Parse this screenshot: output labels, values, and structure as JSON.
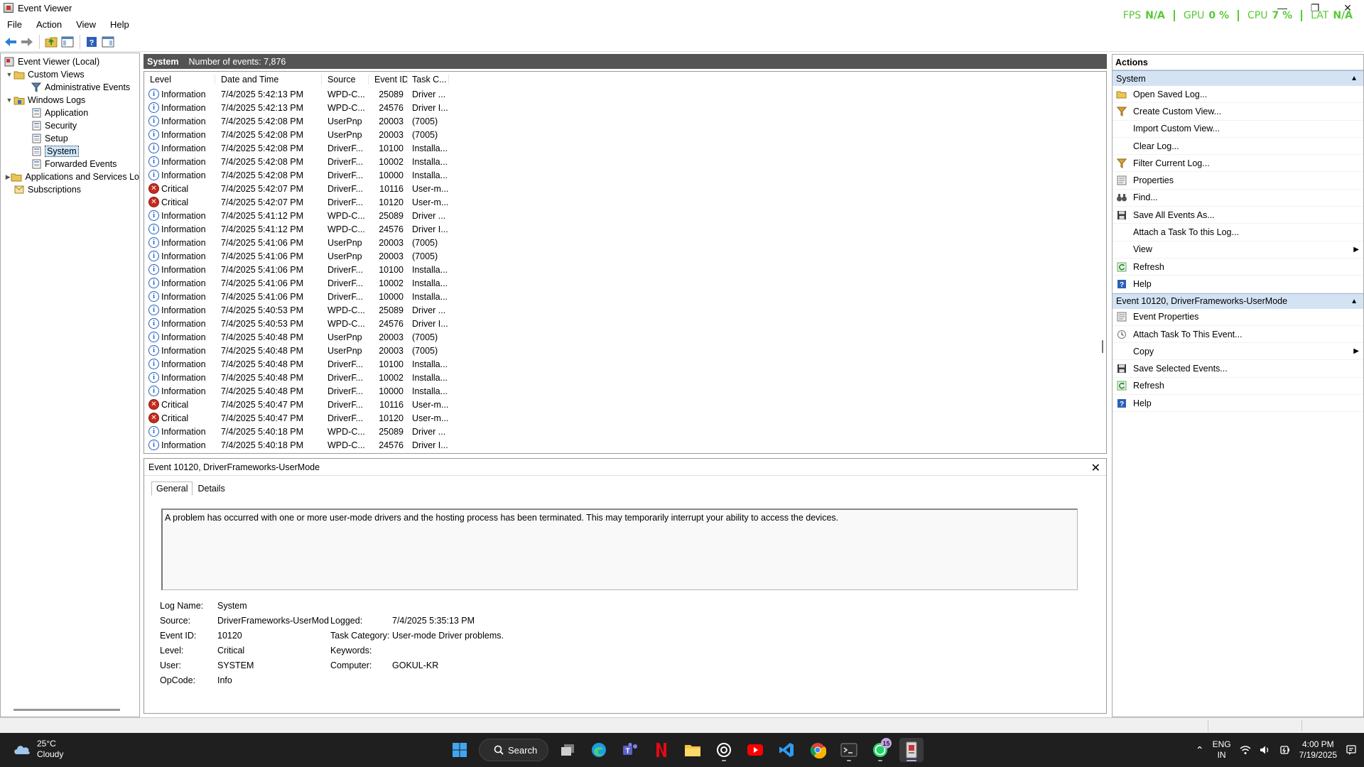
{
  "window": {
    "title": "Event Viewer",
    "minimize": "—",
    "restore": "❐",
    "close": "✕"
  },
  "overlay": {
    "fps_label": "FPS",
    "fps_value": "N/A",
    "gpu_label": "GPU",
    "gpu_value": "0 %",
    "cpu_label": "CPU",
    "cpu_value": "7 %",
    "lat_label": "LAT",
    "lat_value": "N/A",
    "color": "#58c936"
  },
  "menu": {
    "file": "File",
    "action": "Action",
    "view": "View",
    "help": "Help"
  },
  "tree": {
    "root": "Event Viewer (Local)",
    "custom_views": "Custom Views",
    "administrative_events": "Administrative Events",
    "windows_logs": "Windows Logs",
    "application": "Application",
    "security": "Security",
    "setup": "Setup",
    "system": "System",
    "forwarded_events": "Forwarded Events",
    "apps_services": "Applications and Services Lo",
    "subscriptions": "Subscriptions"
  },
  "center": {
    "log_name": "System",
    "count": "Number of events: 7,876"
  },
  "columns": {
    "level": "Level",
    "date": "Date and Time",
    "source": "Source",
    "event_id": "Event ID",
    "task": "Task C..."
  },
  "events": [
    {
      "level": "Information",
      "date": "7/4/2025 5:42:13 PM",
      "source": "WPD-C...",
      "id": "25089",
      "task": "Driver ..."
    },
    {
      "level": "Information",
      "date": "7/4/2025 5:42:13 PM",
      "source": "WPD-C...",
      "id": "24576",
      "task": "Driver I..."
    },
    {
      "level": "Information",
      "date": "7/4/2025 5:42:08 PM",
      "source": "UserPnp",
      "id": "20003",
      "task": "(7005)"
    },
    {
      "level": "Information",
      "date": "7/4/2025 5:42:08 PM",
      "source": "UserPnp",
      "id": "20003",
      "task": "(7005)"
    },
    {
      "level": "Information",
      "date": "7/4/2025 5:42:08 PM",
      "source": "DriverF...",
      "id": "10100",
      "task": "Installa..."
    },
    {
      "level": "Information",
      "date": "7/4/2025 5:42:08 PM",
      "source": "DriverF...",
      "id": "10002",
      "task": "Installa..."
    },
    {
      "level": "Information",
      "date": "7/4/2025 5:42:08 PM",
      "source": "DriverF...",
      "id": "10000",
      "task": "Installa..."
    },
    {
      "level": "Critical",
      "date": "7/4/2025 5:42:07 PM",
      "source": "DriverF...",
      "id": "10116",
      "task": "User-m..."
    },
    {
      "level": "Critical",
      "date": "7/4/2025 5:42:07 PM",
      "source": "DriverF...",
      "id": "10120",
      "task": "User-m..."
    },
    {
      "level": "Information",
      "date": "7/4/2025 5:41:12 PM",
      "source": "WPD-C...",
      "id": "25089",
      "task": "Driver ..."
    },
    {
      "level": "Information",
      "date": "7/4/2025 5:41:12 PM",
      "source": "WPD-C...",
      "id": "24576",
      "task": "Driver I..."
    },
    {
      "level": "Information",
      "date": "7/4/2025 5:41:06 PM",
      "source": "UserPnp",
      "id": "20003",
      "task": "(7005)"
    },
    {
      "level": "Information",
      "date": "7/4/2025 5:41:06 PM",
      "source": "UserPnp",
      "id": "20003",
      "task": "(7005)"
    },
    {
      "level": "Information",
      "date": "7/4/2025 5:41:06 PM",
      "source": "DriverF...",
      "id": "10100",
      "task": "Installa..."
    },
    {
      "level": "Information",
      "date": "7/4/2025 5:41:06 PM",
      "source": "DriverF...",
      "id": "10002",
      "task": "Installa..."
    },
    {
      "level": "Information",
      "date": "7/4/2025 5:41:06 PM",
      "source": "DriverF...",
      "id": "10000",
      "task": "Installa..."
    },
    {
      "level": "Information",
      "date": "7/4/2025 5:40:53 PM",
      "source": "WPD-C...",
      "id": "25089",
      "task": "Driver ..."
    },
    {
      "level": "Information",
      "date": "7/4/2025 5:40:53 PM",
      "source": "WPD-C...",
      "id": "24576",
      "task": "Driver I..."
    },
    {
      "level": "Information",
      "date": "7/4/2025 5:40:48 PM",
      "source": "UserPnp",
      "id": "20003",
      "task": "(7005)"
    },
    {
      "level": "Information",
      "date": "7/4/2025 5:40:48 PM",
      "source": "UserPnp",
      "id": "20003",
      "task": "(7005)"
    },
    {
      "level": "Information",
      "date": "7/4/2025 5:40:48 PM",
      "source": "DriverF...",
      "id": "10100",
      "task": "Installa..."
    },
    {
      "level": "Information",
      "date": "7/4/2025 5:40:48 PM",
      "source": "DriverF...",
      "id": "10002",
      "task": "Installa..."
    },
    {
      "level": "Information",
      "date": "7/4/2025 5:40:48 PM",
      "source": "DriverF...",
      "id": "10000",
      "task": "Installa..."
    },
    {
      "level": "Critical",
      "date": "7/4/2025 5:40:47 PM",
      "source": "DriverF...",
      "id": "10116",
      "task": "User-m..."
    },
    {
      "level": "Critical",
      "date": "7/4/2025 5:40:47 PM",
      "source": "DriverF...",
      "id": "10120",
      "task": "User-m..."
    },
    {
      "level": "Information",
      "date": "7/4/2025 5:40:18 PM",
      "source": "WPD-C...",
      "id": "25089",
      "task": "Driver ..."
    },
    {
      "level": "Information",
      "date": "7/4/2025 5:40:18 PM",
      "source": "WPD-C...",
      "id": "24576",
      "task": "Driver I..."
    }
  ],
  "detail": {
    "header": "Event 10120, DriverFrameworks-UserMode",
    "close": "✕",
    "tab_general": "General",
    "tab_details": "Details",
    "description": "A problem has occurred with one or more user-mode drivers and the hosting process has been terminated.  This may temporarily interrupt your ability to access the devices.",
    "log_name_label": "Log Name:",
    "log_name": "System",
    "source_label": "Source:",
    "source": "DriverFrameworks-UserMod",
    "logged_label": "Logged:",
    "logged": "7/4/2025 5:35:13 PM",
    "event_id_label": "Event ID:",
    "event_id": "10120",
    "task_label": "Task Category:",
    "task": "User-mode Driver problems.",
    "level_label": "Level:",
    "level": "Critical",
    "keywords_label": "Keywords:",
    "keywords": "",
    "user_label": "User:",
    "user": "SYSTEM",
    "computer_label": "Computer:",
    "computer": "GOKUL-KR",
    "opcode_label": "OpCode:",
    "opcode": "Info"
  },
  "actions": {
    "title": "Actions",
    "section_system": "System",
    "system_items": [
      {
        "label": "Open Saved Log...",
        "icon": "open-folder-icon"
      },
      {
        "label": "Create Custom View...",
        "icon": "filter-icon"
      },
      {
        "label": "Import Custom View...",
        "icon": ""
      },
      {
        "label": "Clear Log...",
        "icon": ""
      },
      {
        "label": "Filter Current Log...",
        "icon": "filter-icon"
      },
      {
        "label": "Properties",
        "icon": "properties-icon"
      },
      {
        "label": "Find...",
        "icon": "binoculars-icon"
      },
      {
        "label": "Save All Events As...",
        "icon": "save-icon"
      },
      {
        "label": "Attach a Task To this Log...",
        "icon": ""
      },
      {
        "label": "View",
        "icon": "",
        "submenu": true
      },
      {
        "label": "Refresh",
        "icon": "refresh-icon"
      },
      {
        "label": "Help",
        "icon": "help-icon"
      }
    ],
    "section_event": "Event 10120, DriverFrameworks-UserMode",
    "event_items": [
      {
        "label": "Event Properties",
        "icon": "properties-icon"
      },
      {
        "label": "Attach Task To This Event...",
        "icon": "task-icon"
      },
      {
        "label": "Copy",
        "icon": "",
        "submenu": true
      },
      {
        "label": "Save Selected Events...",
        "icon": "save-icon"
      },
      {
        "label": "Refresh",
        "icon": "refresh-icon"
      },
      {
        "label": "Help",
        "icon": "help-icon"
      }
    ]
  },
  "taskbar": {
    "temp": "25°C",
    "condition": "Cloudy",
    "search": "Search",
    "whatsapp_badge": "15",
    "lang1": "ENG",
    "lang2": "IN",
    "time": "4:00 PM",
    "date": "7/19/2025"
  }
}
